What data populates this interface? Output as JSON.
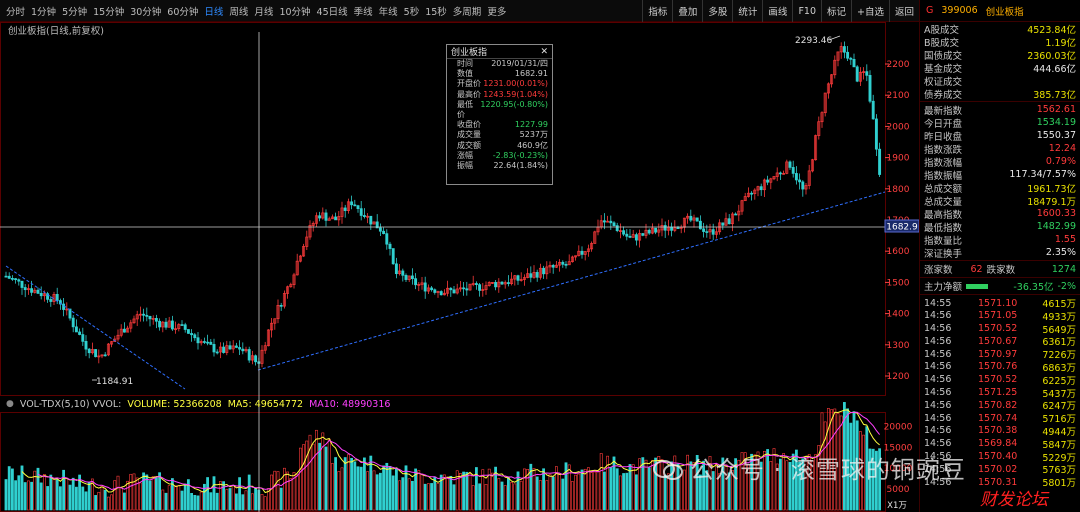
{
  "toolbar": {
    "periods": [
      "分时",
      "1分钟",
      "5分钟",
      "15分钟",
      "30分钟",
      "60分钟",
      "日线",
      "周线",
      "月线",
      "10分钟",
      "45日线",
      "季线",
      "年线",
      "5秒",
      "15秒",
      "多周期",
      "更多"
    ],
    "active_period": "日线",
    "tools": [
      "指标",
      "叠加",
      "多股",
      "统计",
      "画线",
      "F10",
      "标记",
      "+自选",
      "返回"
    ]
  },
  "chart": {
    "title": "创业板指(日线,前复权)",
    "price_axis": [
      "2200",
      "2100",
      "2000",
      "1900",
      "1800",
      "1700",
      "1600",
      "1500",
      "1400",
      "1300",
      "1200"
    ],
    "cursor_price": "1682.9",
    "high_label": "2293.46",
    "low_label": "1184.91",
    "volume_axis": [
      "20000",
      "15000",
      "10000",
      "5000"
    ],
    "volume_unit": "X1万",
    "vol_indicator": {
      "name": "VOL-TDX(5,10) VVOL:",
      "volume": "VOLUME: 52366208",
      "ma5": "MA5: 49654772",
      "ma10": "MA10: 48990316"
    },
    "colors": {
      "up": "#ff3b3b",
      "down": "#30d0d0",
      "ma5": "#ffff40",
      "ma10": "#ff40ff",
      "trend": "#2f6fff"
    }
  },
  "tooltip": {
    "title": "创业板指",
    "rows": [
      {
        "label": "时间",
        "value": "2019/01/31/四",
        "tone": ""
      },
      {
        "label": "数值",
        "value": "1682.91",
        "tone": ""
      },
      {
        "label": "开盘价",
        "value": "1231.00(0.01%)",
        "tone": "up"
      },
      {
        "label": "最高价",
        "value": "1243.59(1.04%)",
        "tone": "up"
      },
      {
        "label": "最低价",
        "value": "1220.95(-0.80%)",
        "tone": "dn"
      },
      {
        "label": "收盘价",
        "value": "1227.99",
        "tone": "dn"
      },
      {
        "label": "成交量",
        "value": "5237万",
        "tone": ""
      },
      {
        "label": "成交额",
        "value": "460.9亿",
        "tone": ""
      },
      {
        "label": "涨幅",
        "value": "-2.83(-0.23%)",
        "tone": "dn"
      },
      {
        "label": "振幅",
        "value": "22.64(1.84%)",
        "tone": ""
      }
    ]
  },
  "panel": {
    "marker": "G",
    "code": "399006",
    "name": "创业板指",
    "turnover": [
      {
        "label": "A股成交",
        "value": "4523.84亿",
        "tone": ""
      },
      {
        "label": "B股成交",
        "value": "1.19亿",
        "tone": ""
      },
      {
        "label": "国债成交",
        "value": "2360.03亿",
        "tone": ""
      },
      {
        "label": "基金成交",
        "value": "444.66亿",
        "tone": "w"
      },
      {
        "label": "权证成交",
        "value": "",
        "tone": ""
      },
      {
        "label": "债券成交",
        "value": "385.73亿",
        "tone": ""
      }
    ],
    "stats": [
      {
        "label": "最新指数",
        "value": "1562.61",
        "tone": "up"
      },
      {
        "label": "今日开盘",
        "value": "1534.19",
        "tone": "dn"
      },
      {
        "label": "昨日收盘",
        "value": "1550.37",
        "tone": "w"
      },
      {
        "label": "指数涨跌",
        "value": "12.24",
        "tone": "up"
      },
      {
        "label": "指数涨幅",
        "value": "0.79%",
        "tone": "up"
      },
      {
        "label": "指数振幅",
        "value": "117.34/7.57%",
        "tone": "w"
      },
      {
        "label": "总成交额",
        "value": "1961.73亿",
        "tone": ""
      },
      {
        "label": "总成交量",
        "value": "18479.1万",
        "tone": ""
      },
      {
        "label": "最高指数",
        "value": "1600.33",
        "tone": "up"
      },
      {
        "label": "最低指数",
        "value": "1482.99",
        "tone": "dn"
      },
      {
        "label": "指数量比",
        "value": "1.55",
        "tone": "up"
      },
      {
        "label": "深证换手",
        "value": "2.35%",
        "tone": "w"
      }
    ],
    "breadth": {
      "up_label": "涨家数",
      "up_value": "62",
      "down_label": "跌家数",
      "down_value": "1274"
    },
    "flow": {
      "label": "主力净额",
      "value": "-36.35亿",
      "pct": "-2%"
    },
    "ticks": [
      {
        "time": "14:55",
        "price": "1571.10",
        "vol": "4615万"
      },
      {
        "time": "14:56",
        "price": "1571.05",
        "vol": "4933万"
      },
      {
        "time": "14:56",
        "price": "1570.52",
        "vol": "5649万"
      },
      {
        "time": "14:56",
        "price": "1570.67",
        "vol": "6361万"
      },
      {
        "time": "14:56",
        "price": "1570.97",
        "vol": "7226万"
      },
      {
        "time": "14:56",
        "price": "1570.76",
        "vol": "6863万"
      },
      {
        "time": "14:56",
        "price": "1570.52",
        "vol": "6225万"
      },
      {
        "time": "14:56",
        "price": "1571.25",
        "vol": "5437万"
      },
      {
        "time": "14:56",
        "price": "1570.82",
        "vol": "6247万"
      },
      {
        "time": "14:56",
        "price": "1570.74",
        "vol": "5716万"
      },
      {
        "time": "14:56",
        "price": "1570.38",
        "vol": "4944万"
      },
      {
        "time": "14:56",
        "price": "1569.84",
        "vol": "5847万"
      },
      {
        "time": "14:56",
        "price": "1570.40",
        "vol": "5229万"
      },
      {
        "time": "14:56",
        "price": "1570.02",
        "vol": "5763万"
      },
      {
        "time": "14:56",
        "price": "1570.31",
        "vol": "5801万"
      }
    ]
  },
  "watermark": {
    "text": "公众号 · 滚雪球的铜豌豆",
    "stamp": "财发论坛"
  }
}
